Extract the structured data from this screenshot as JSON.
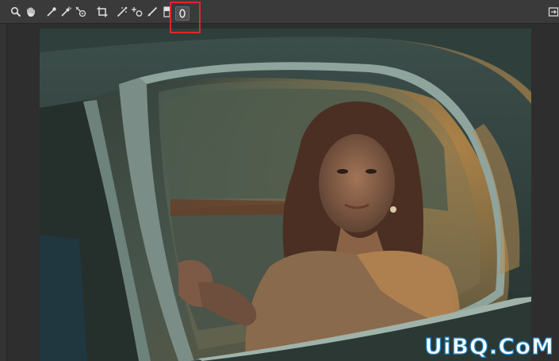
{
  "toolbar": {
    "tools": [
      {
        "name": "zoom-tool",
        "icon": "zoom-icon"
      },
      {
        "name": "hand-tool",
        "icon": "hand-icon"
      },
      {
        "name": "white-balance-tool",
        "icon": "eyedropper-icon"
      },
      {
        "name": "color-sampler-tool",
        "icon": "color-sampler-icon"
      },
      {
        "name": "targeted-adjustment-tool",
        "icon": "target-adjust-icon"
      },
      {
        "name": "crop-tool",
        "icon": "crop-icon"
      },
      {
        "name": "straighten-tool",
        "icon": "straighten-icon"
      },
      {
        "name": "red-eye-tool",
        "icon": "red-eye-icon"
      },
      {
        "name": "adjustment-brush-tool",
        "icon": "brush-icon"
      },
      {
        "name": "graduated-filter-tool",
        "icon": "graduated-filter-icon"
      },
      {
        "name": "radial-filter-tool",
        "icon": "radial-filter-icon",
        "active": true
      }
    ],
    "right_icon": "open-preferences-icon"
  },
  "colors": {
    "toolbar_bg": "#3a3a3a",
    "canvas_bg": "#2e2e2e",
    "highlight": "#e32626",
    "watermark_stroke": "#1f86c7"
  },
  "watermark": {
    "text": "UiBQ.CoM"
  }
}
